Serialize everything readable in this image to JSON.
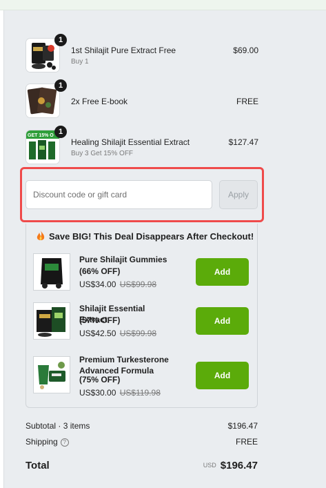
{
  "line_items": [
    {
      "title": "1st Shilajit Pure Extract Free",
      "subtitle": "Buy 1",
      "price": "$69.00",
      "qty": "1"
    },
    {
      "title": "2x Free E-book",
      "subtitle": "",
      "price": "FREE",
      "qty": "1"
    },
    {
      "title": "Healing Shilajit Essential Extract",
      "subtitle": "Buy 3 Get 15% OFF",
      "price": "$127.47",
      "qty": "1",
      "thumb_text": "GET 15% O"
    }
  ],
  "discount": {
    "placeholder": "Discount code or gift card",
    "apply_label": "Apply"
  },
  "upsell": {
    "title": "Save BIG! This Deal Disappears After Checkout!",
    "offers": [
      {
        "name": "Pure Shilajit Gummies",
        "pct": "(66% OFF)",
        "price": "US$34.00",
        "was": "US$99.98",
        "add_label": "Add"
      },
      {
        "name": "Shilajit Essential Extract",
        "pct": "(57% OFF)",
        "price": "US$42.50",
        "was": "US$99.98",
        "add_label": "Add"
      },
      {
        "name": "Premium Turkesterone Advanced Formula",
        "pct": "(75% OFF)",
        "price": "US$30.00",
        "was": "US$119.98",
        "add_label": "Add"
      }
    ]
  },
  "summary": {
    "subtotal_label": "Subtotal · 3 items",
    "subtotal_value": "$196.47",
    "shipping_label": "Shipping",
    "shipping_value": "FREE",
    "total_label": "Total",
    "total_currency": "USD",
    "total_value": "$196.47"
  },
  "colors": {
    "accent_green": "#5bab0a",
    "highlight_red": "#ef4a4a",
    "panel_bg": "#eaedf0"
  }
}
